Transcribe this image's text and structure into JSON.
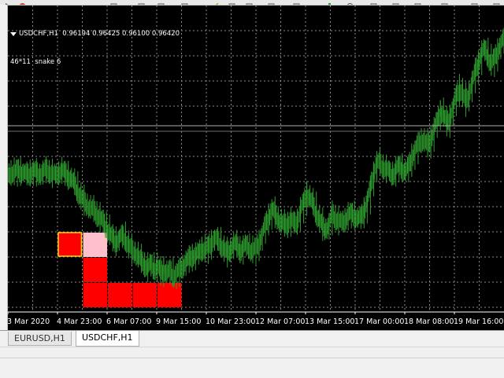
{
  "window": {
    "symbol_info": "USDCHF,H1  0.96194 0.96425 0.96100 0.96420",
    "indicator_info": "46*11  snake 6"
  },
  "colors": {
    "chart_bg": "#000000",
    "grid": "#8a8a8a",
    "candles": "#2e9e2e",
    "snake_body": "#ff0000",
    "snake_head_border": "#ffd700",
    "snake_target": "#ffc0cb"
  },
  "time_axis": [
    "3 Mar 2020",
    "4 Mar 23:00",
    "6 Mar 07:00",
    "9 Mar 15:00",
    "10 Mar 23:00",
    "12 Mar 07:00",
    "13 Mar 15:00",
    "17 Mar 00:00",
    "18 Mar 08:00",
    "19 Mar 16:00"
  ],
  "tabs": [
    {
      "label": "EURUSD,H1",
      "active": false
    },
    {
      "label": "USDCHF,H1",
      "active": true
    }
  ],
  "snake_game": {
    "grid": {
      "cols": 20,
      "rows": 12
    },
    "head": [
      2,
      9
    ],
    "body": [
      [
        3,
        10
      ],
      [
        3,
        11
      ],
      [
        4,
        11
      ],
      [
        5,
        11
      ],
      [
        6,
        11
      ]
    ],
    "food": [
      3,
      9
    ]
  },
  "price_series": [
    0.9435,
    0.9442,
    0.9438,
    0.9445,
    0.9441,
    0.944,
    0.9436,
    0.9439,
    0.9443,
    0.944,
    0.9437,
    0.9441,
    0.9444,
    0.9442,
    0.9438,
    0.9436,
    0.944,
    0.9443,
    0.9439,
    0.9435,
    0.943,
    0.9422,
    0.9412,
    0.9405,
    0.9398,
    0.9392,
    0.9388,
    0.9385,
    0.938,
    0.9375,
    0.9368,
    0.936,
    0.9352,
    0.9345,
    0.934,
    0.9346,
    0.935,
    0.9343,
    0.9335,
    0.9328,
    0.9325,
    0.9318,
    0.9312,
    0.9308,
    0.9303,
    0.931,
    0.93,
    0.9306,
    0.9296,
    0.9302,
    0.9294,
    0.93,
    0.9291,
    0.9296,
    0.93,
    0.9306,
    0.9312,
    0.9316,
    0.9322,
    0.932,
    0.9326,
    0.9332,
    0.9327,
    0.9335,
    0.934,
    0.9346,
    0.9342,
    0.9336,
    0.933,
    0.9324,
    0.933,
    0.9338,
    0.9335,
    0.9328,
    0.9332,
    0.9337,
    0.933,
    0.9326,
    0.9333,
    0.934,
    0.9352,
    0.9366,
    0.9376,
    0.9388,
    0.938,
    0.9372,
    0.9368,
    0.9364,
    0.9368,
    0.9373,
    0.9365,
    0.9372,
    0.9385,
    0.9398,
    0.941,
    0.9402,
    0.9393,
    0.938,
    0.9372,
    0.9362,
    0.9358,
    0.9366,
    0.938,
    0.9375,
    0.937,
    0.9368,
    0.9373,
    0.9378,
    0.9382,
    0.9378,
    0.9373,
    0.9376,
    0.9385,
    0.94,
    0.9418,
    0.944,
    0.9455,
    0.9452,
    0.9448,
    0.9445,
    0.944,
    0.9436,
    0.9444,
    0.945,
    0.9446,
    0.944,
    0.945,
    0.9462,
    0.9472,
    0.948,
    0.9488,
    0.9484,
    0.9478,
    0.949,
    0.9502,
    0.9515,
    0.9528,
    0.9522,
    0.951,
    0.952,
    0.9535,
    0.955,
    0.9562,
    0.9552,
    0.954,
    0.9555,
    0.957,
    0.9585,
    0.96,
    0.9612,
    0.9618,
    0.9605,
    0.9595,
    0.9605,
    0.9615,
    0.9625,
    0.9632
  ]
}
